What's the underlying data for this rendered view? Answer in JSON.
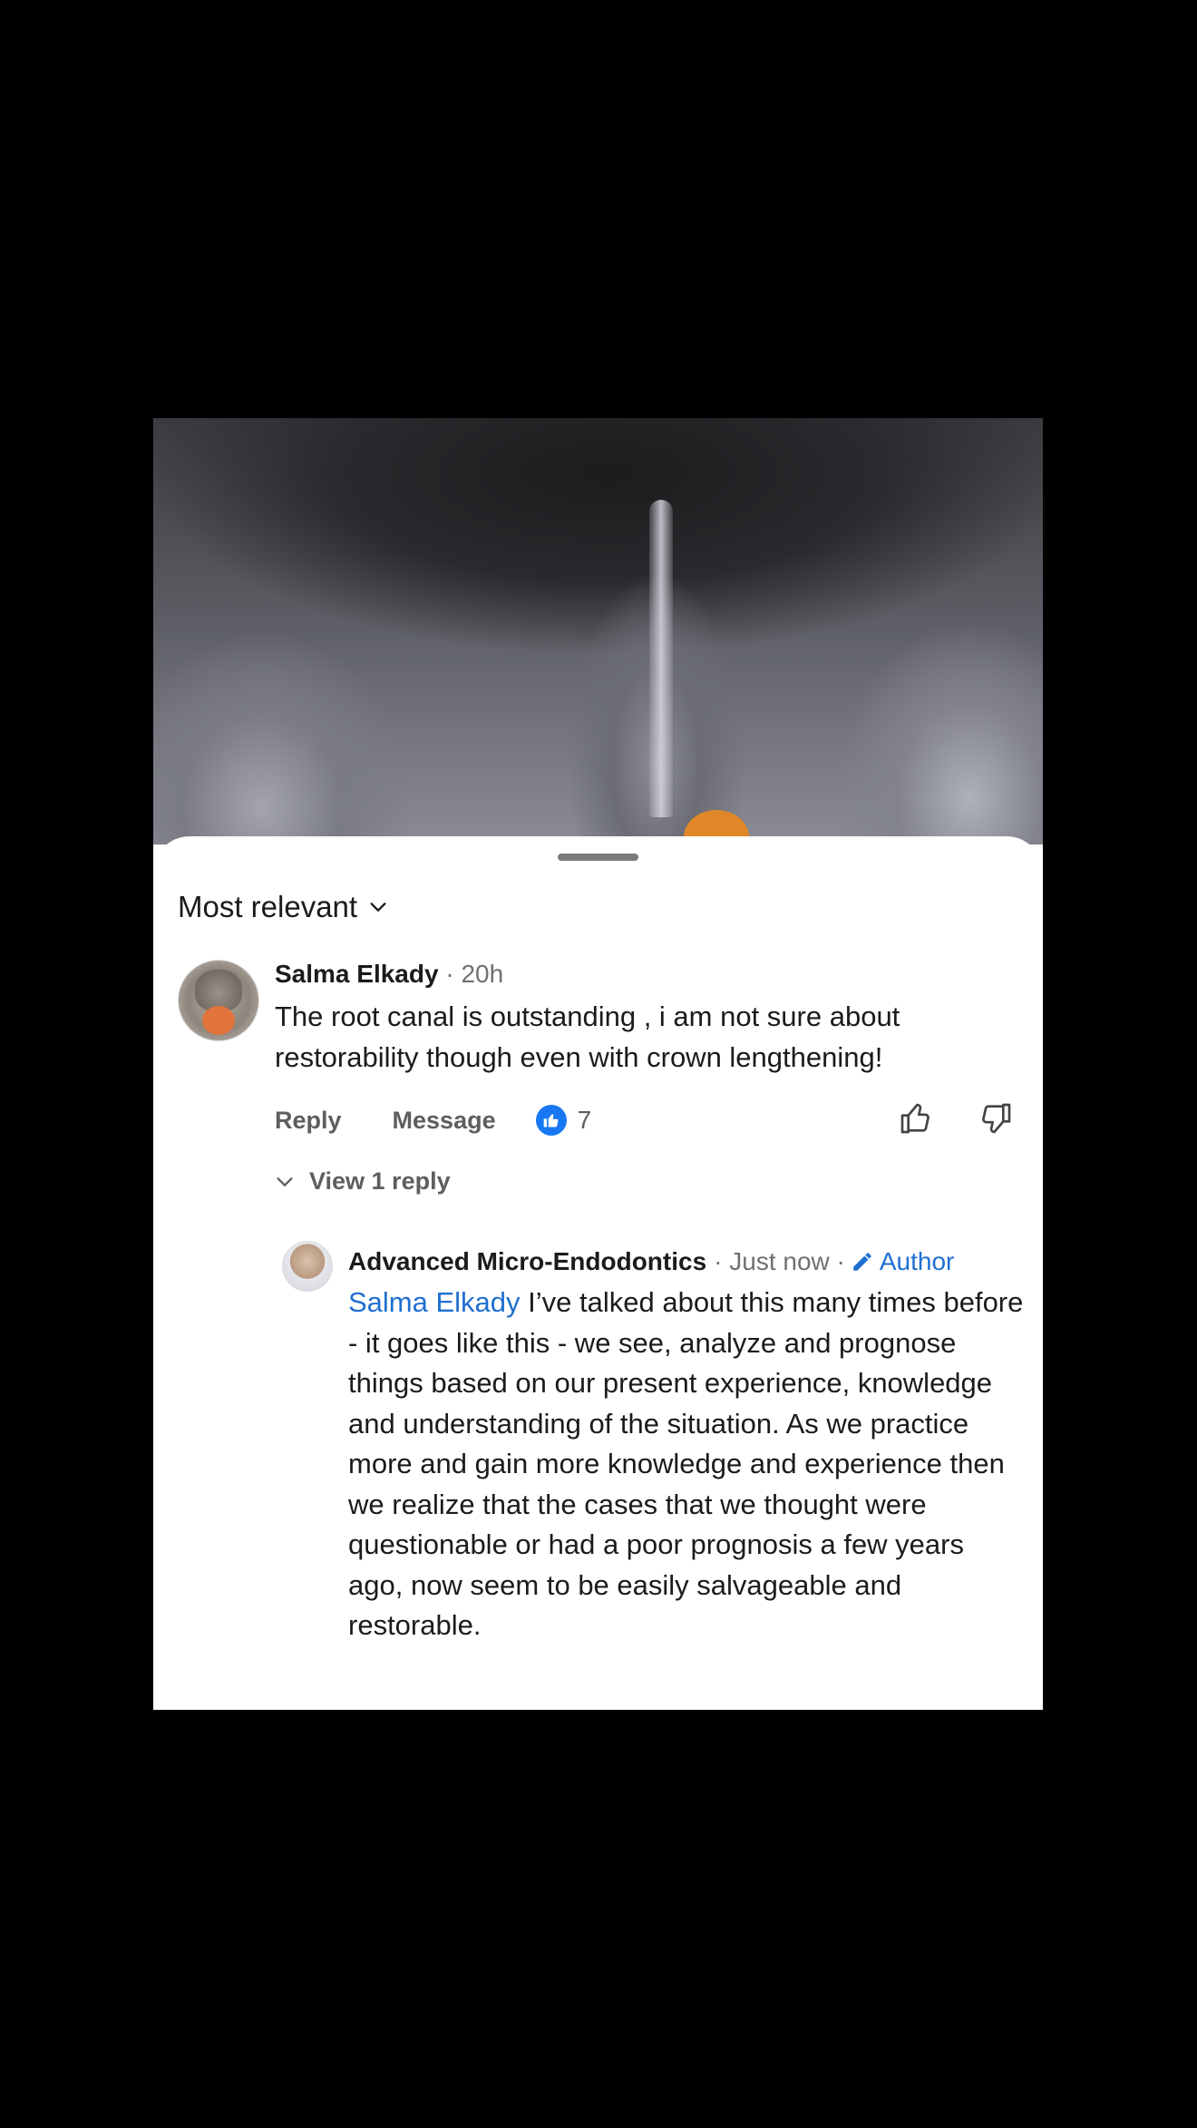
{
  "sort": {
    "label": "Most relevant"
  },
  "comment": {
    "author": "Salma Elkady",
    "meta": " · 20h",
    "text": "The root canal is outstanding , i am not sure about restorability though even with crown lengthening!",
    "reply_label": "Reply",
    "message_label": "Message",
    "like_count": "7",
    "view_replies_label": "View 1 reply"
  },
  "reply": {
    "author": "Advanced Micro-Endodontics",
    "meta": "· Just now ·",
    "badge_label": "Author",
    "mention": "Salma Elkady",
    "text": " I’ve talked about this many times before - it goes like this - we see, analyze and prognose things based on our present experience, knowledge and understanding of the situation. As we practice more and gain more knowledge and experience then we realize that the cases that we thought were questionable or had a poor prognosis a few years ago, now seem to be easily salvageable and restorable."
  },
  "colors": {
    "accent": "#1f6fd1",
    "like_badge": "#1877f2",
    "text": "#1b1b1b",
    "muted": "#5e5e5e"
  },
  "icons": [
    "chevron-down-icon",
    "like-badge-icon",
    "thumbs-up-icon",
    "thumbs-down-icon",
    "pencil-icon"
  ]
}
